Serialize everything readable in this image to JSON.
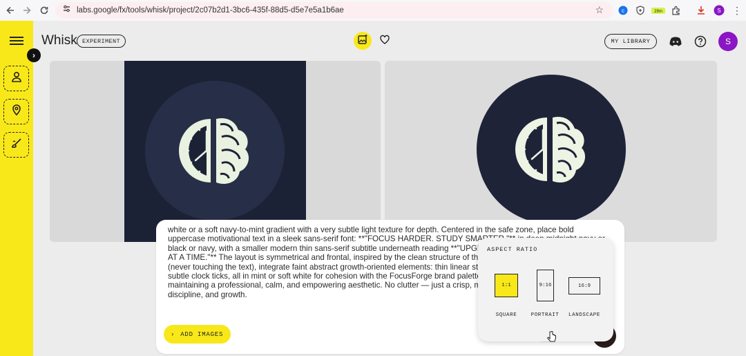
{
  "browser": {
    "url": "labs.google/fx/tools/whisk/project/2c07b2d1-3bc6-435f-88d5-d5e7e5a1b6ae",
    "extension_badge": "29m",
    "profile_initial": "S"
  },
  "app": {
    "brand": "Whisk",
    "badge": "EXPERIMENT",
    "my_library": "MY LIBRARY",
    "avatar_initial": "S"
  },
  "prompt": {
    "text": "white or a soft navy-to-mint gradient with a very subtle light texture for depth. Centered in the safe zone, place bold uppercase motivational text in a sleek sans-serif font: **\"FOCUS HARDER. STUDY SMARTER.\"** in deep midnight navy or black or navy, with a smaller modern thin sans-serif subtitle underneath reading **\"UPGRADE YOUR MIND, ONE SESSION AT A TIME.\"** The layout is symmetrical and frontal, inspired by the clean structure of the composition. Around the edges (never touching the text), integrate faint abstract growth-oriented elements: thin linear stepping paths, a rising sunrise arc, or subtle clock ticks, all in mint or soft white for cohesion with the FocusForge brand palette, with optional gentle ambient glow, maintaining a professional, calm, and empowering aesthetic. No clutter — just a crisp, motivational banner embodying focus, discipline, and growth.",
    "add_images": "ADD IMAGES"
  },
  "aspect_ratio": {
    "title": "ASPECT RATIO",
    "options": [
      {
        "ratio": "1:1",
        "label": "SQUARE",
        "selected": true
      },
      {
        "ratio": "9:16",
        "label": "PORTRAIT",
        "selected": false
      },
      {
        "ratio": "16:9",
        "label": "LANDSCAPE",
        "selected": false
      }
    ]
  },
  "colors": {
    "accent": "#f8e81a",
    "image_bg": "#1c2236",
    "icon_mint": "#e9f1e0",
    "avatar": "#8b16c4"
  }
}
